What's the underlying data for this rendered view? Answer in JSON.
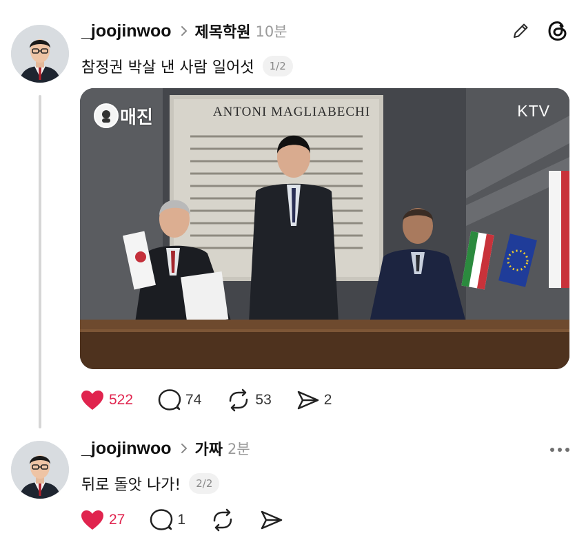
{
  "posts": [
    {
      "username": "_joojinwoo",
      "topic": "제목학원",
      "time": "10분",
      "text": "참정권 박살 낸 사람 일어섯",
      "pager": "1/2",
      "media": {
        "badge": "매진",
        "network": "KTV",
        "plaque_title": "ANTONI MAGLIABECHI"
      },
      "likes": "522",
      "comments": "74",
      "reposts": "53",
      "shares": "2"
    },
    {
      "username": "_joojinwoo",
      "topic": "가짜",
      "time": "2분",
      "text": "뒤로 돌앗 나가!",
      "pager": "2/2",
      "likes": "27",
      "comments": "1"
    }
  ],
  "icons": {
    "edit": "pencil-icon",
    "app": "threads-logo-icon",
    "more": "more-options-icon",
    "like": "heart-icon",
    "comment": "comment-bubble-icon",
    "repost": "repost-icon",
    "share": "share-send-icon",
    "chevron": "chevron-right-icon"
  },
  "colors": {
    "like": "#e0244e",
    "muted": "#9a9a9a",
    "text": "#101010"
  }
}
